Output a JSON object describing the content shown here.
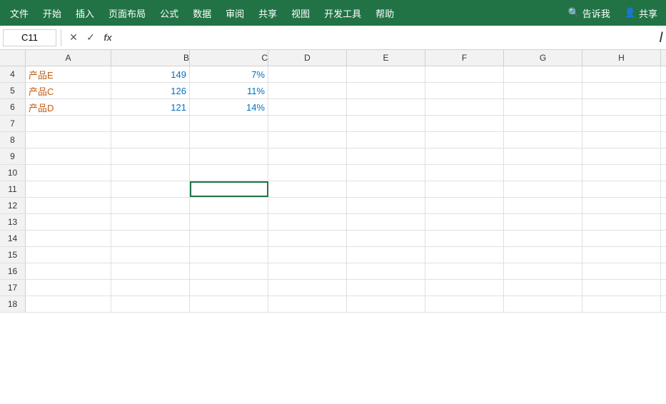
{
  "menubar": {
    "items": [
      "文件",
      "开始",
      "插入",
      "页面布局",
      "公式",
      "数据",
      "审阅",
      "共享",
      "视图",
      "开发工具",
      "帮助"
    ],
    "right_items": [
      "告诉我",
      "共享"
    ],
    "search_placeholder": "告诉我",
    "share_label": "共享"
  },
  "formulabar": {
    "cell_ref": "C11",
    "formula_content": "",
    "cancel_icon": "✕",
    "confirm_icon": "✓",
    "fx_label": "fx"
  },
  "columns": [
    "A",
    "B",
    "C",
    "D",
    "E",
    "F",
    "G",
    "H"
  ],
  "rows": [
    {
      "row_num": "4",
      "a": "产品E",
      "b": "149",
      "c": "7%",
      "d": "",
      "e": "",
      "f": "",
      "g": "",
      "h": ""
    },
    {
      "row_num": "5",
      "a": "产品C",
      "b": "126",
      "c": "11%",
      "d": "",
      "e": "",
      "f": "",
      "g": "",
      "h": ""
    },
    {
      "row_num": "6",
      "a": "产品D",
      "b": "121",
      "c": "14%",
      "d": "",
      "e": "",
      "f": "",
      "g": "",
      "h": ""
    },
    {
      "row_num": "7",
      "a": "",
      "b": "",
      "c": "",
      "d": "",
      "e": "",
      "f": "",
      "g": "",
      "h": ""
    },
    {
      "row_num": "8",
      "a": "",
      "b": "",
      "c": "",
      "d": "",
      "e": "",
      "f": "",
      "g": "",
      "h": ""
    },
    {
      "row_num": "9",
      "a": "",
      "b": "",
      "c": "",
      "d": "",
      "e": "",
      "f": "",
      "g": "",
      "h": ""
    },
    {
      "row_num": "10",
      "a": "",
      "b": "",
      "c": "",
      "d": "",
      "e": "",
      "f": "",
      "g": "",
      "h": ""
    },
    {
      "row_num": "11",
      "a": "",
      "b": "",
      "c": "",
      "d": "",
      "e": "",
      "f": "",
      "g": "",
      "h": ""
    },
    {
      "row_num": "12",
      "a": "",
      "b": "",
      "c": "",
      "d": "",
      "e": "",
      "f": "",
      "g": "",
      "h": ""
    },
    {
      "row_num": "13",
      "a": "",
      "b": "",
      "c": "",
      "d": "",
      "e": "",
      "f": "",
      "g": "",
      "h": ""
    },
    {
      "row_num": "14",
      "a": "",
      "b": "",
      "c": "",
      "d": "",
      "e": "",
      "f": "",
      "g": "",
      "h": ""
    },
    {
      "row_num": "15",
      "a": "",
      "b": "",
      "c": "",
      "d": "",
      "e": "",
      "f": "",
      "g": "",
      "h": ""
    },
    {
      "row_num": "16",
      "a": "",
      "b": "",
      "c": "",
      "d": "",
      "e": "",
      "f": "",
      "g": "",
      "h": ""
    },
    {
      "row_num": "17",
      "a": "",
      "b": "",
      "c": "",
      "d": "",
      "e": "",
      "f": "",
      "g": "",
      "h": ""
    },
    {
      "row_num": "18",
      "a": "",
      "b": "",
      "c": "",
      "d": "",
      "e": "",
      "f": "",
      "g": "",
      "h": ""
    }
  ],
  "colors": {
    "excel_green": "#217346",
    "text_blue": "#0070c0",
    "text_orange": "#c55a11"
  }
}
